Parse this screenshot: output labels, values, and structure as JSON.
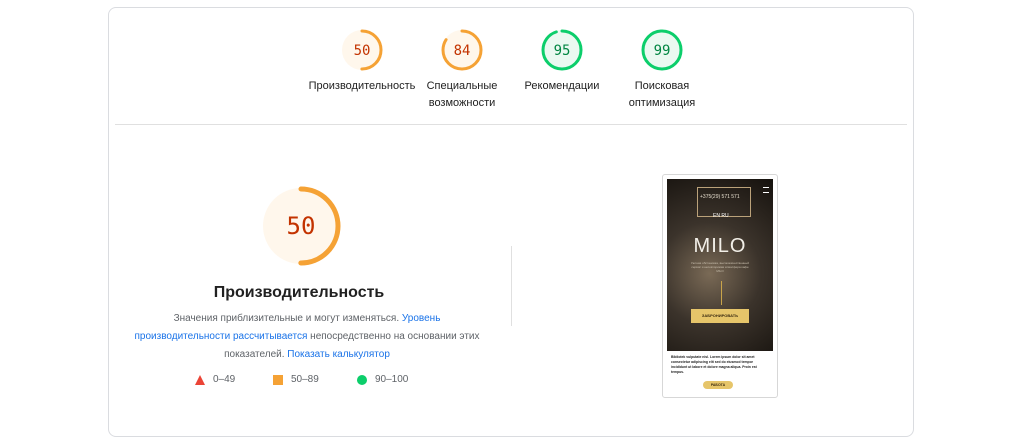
{
  "scores": [
    {
      "value": "50",
      "label_line1": "Производительность",
      "label_line2": "",
      "status": "average"
    },
    {
      "value": "84",
      "label_line1": "Специальные",
      "label_line2": "возможности",
      "status": "average"
    },
    {
      "value": "95",
      "label_line1": "Рекомендации",
      "label_line2": "",
      "status": "pass"
    },
    {
      "value": "99",
      "label_line1": "Поисковая",
      "label_line2": "оптимизация",
      "status": "pass"
    }
  ],
  "main": {
    "score": "50",
    "title": "Производительность",
    "desc_part1": "Значения приблизительные и могут изменяться. ",
    "desc_link1": "Уровень производительности рассчитывается",
    "desc_part2": " непосредственно на основании этих показателей. ",
    "desc_link2": "Показать калькулятор"
  },
  "legend": [
    {
      "range": "0–49",
      "shape": "triangle",
      "color": "#eb4436"
    },
    {
      "range": "50–89",
      "shape": "square",
      "color": "#f5a235"
    },
    {
      "range": "90–100",
      "shape": "circle",
      "color": "#0cce6b"
    }
  ],
  "preview": {
    "phone": "+375(29) 571 571",
    "lang": "EN  RU",
    "title": "MILO",
    "subtitle": "Уютная обстановка, высококачественный сервис и неповторимая атмосфера кафе MILO",
    "button": "ЗАБРОНИРОВАТЬ",
    "paragraph": "Bibliotek vulputate nisl. Lorem ipsum dolor sit amet consectetur adipiscing elit sed do eiusmod tempor incididunt ut labore et dolore magna aliqua. Proin est tempus.",
    "button2": "РАБОТА"
  },
  "colors": {
    "average": "#f5a235",
    "average_bg": "#fff7ec",
    "pass": "#0cce6b",
    "pass_bg": "#eaf9f1",
    "average_text": "#c33300",
    "pass_text": "#018642"
  }
}
